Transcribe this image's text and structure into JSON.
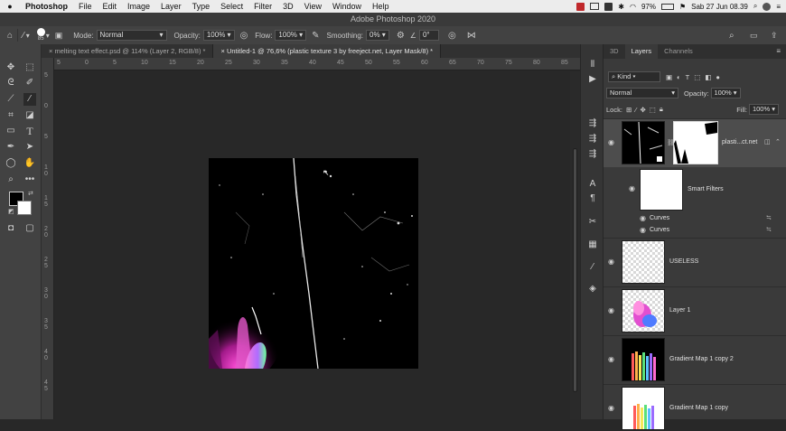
{
  "menubar": {
    "app": "Photoshop",
    "items": [
      "File",
      "Edit",
      "Image",
      "Layer",
      "Type",
      "Select",
      "Filter",
      "3D",
      "View",
      "Window",
      "Help"
    ],
    "battery": "97%",
    "clock": "Sab 27 Jun  08.39"
  },
  "window_title": "Adobe Photoshop 2020",
  "options": {
    "brush_size": "85",
    "mode_label": "Mode:",
    "mode_value": "Normal",
    "opacity_label": "Opacity:",
    "opacity_value": "100%",
    "flow_label": "Flow:",
    "flow_value": "100%",
    "smoothing_label": "Smoothing:",
    "smoothing_value": "0%",
    "angle_value": "0°"
  },
  "tabs": [
    {
      "label": "melting text effect.psd @ 114% (Layer 2, RGB/8) *"
    },
    {
      "label": "Untitled-1 @ 76,6% (plastic texture 3 by freeject.net, Layer Mask/8) *"
    }
  ],
  "ruler_h": [
    "5",
    "0",
    "5",
    "10",
    "15",
    "20",
    "25",
    "30",
    "35",
    "40",
    "45",
    "50",
    "55",
    "60",
    "65",
    "70",
    "75",
    "80",
    "85"
  ],
  "ruler_v": [
    "5",
    "0",
    "5",
    "10",
    "15",
    "20",
    "25",
    "30",
    "35",
    "40",
    "45"
  ],
  "layers_panel": {
    "tabs": [
      "3D",
      "Layers",
      "Channels"
    ],
    "filter_value": "Kind",
    "blend_value": "Normal",
    "opacity_label": "Opacity:",
    "opacity_value": "100%",
    "lock_label": "Lock:",
    "fill_label": "Fill:",
    "fill_value": "100%",
    "layers": [
      {
        "name": "plasti...ct.net"
      },
      {
        "name": "Smart Filters"
      },
      {
        "name": "Curves"
      },
      {
        "name": "Curves"
      },
      {
        "name": "USELESS"
      },
      {
        "name": "Layer 1"
      },
      {
        "name": "Gradient Map 1 copy 2"
      },
      {
        "name": "Gradient Map 1 copy"
      }
    ]
  }
}
